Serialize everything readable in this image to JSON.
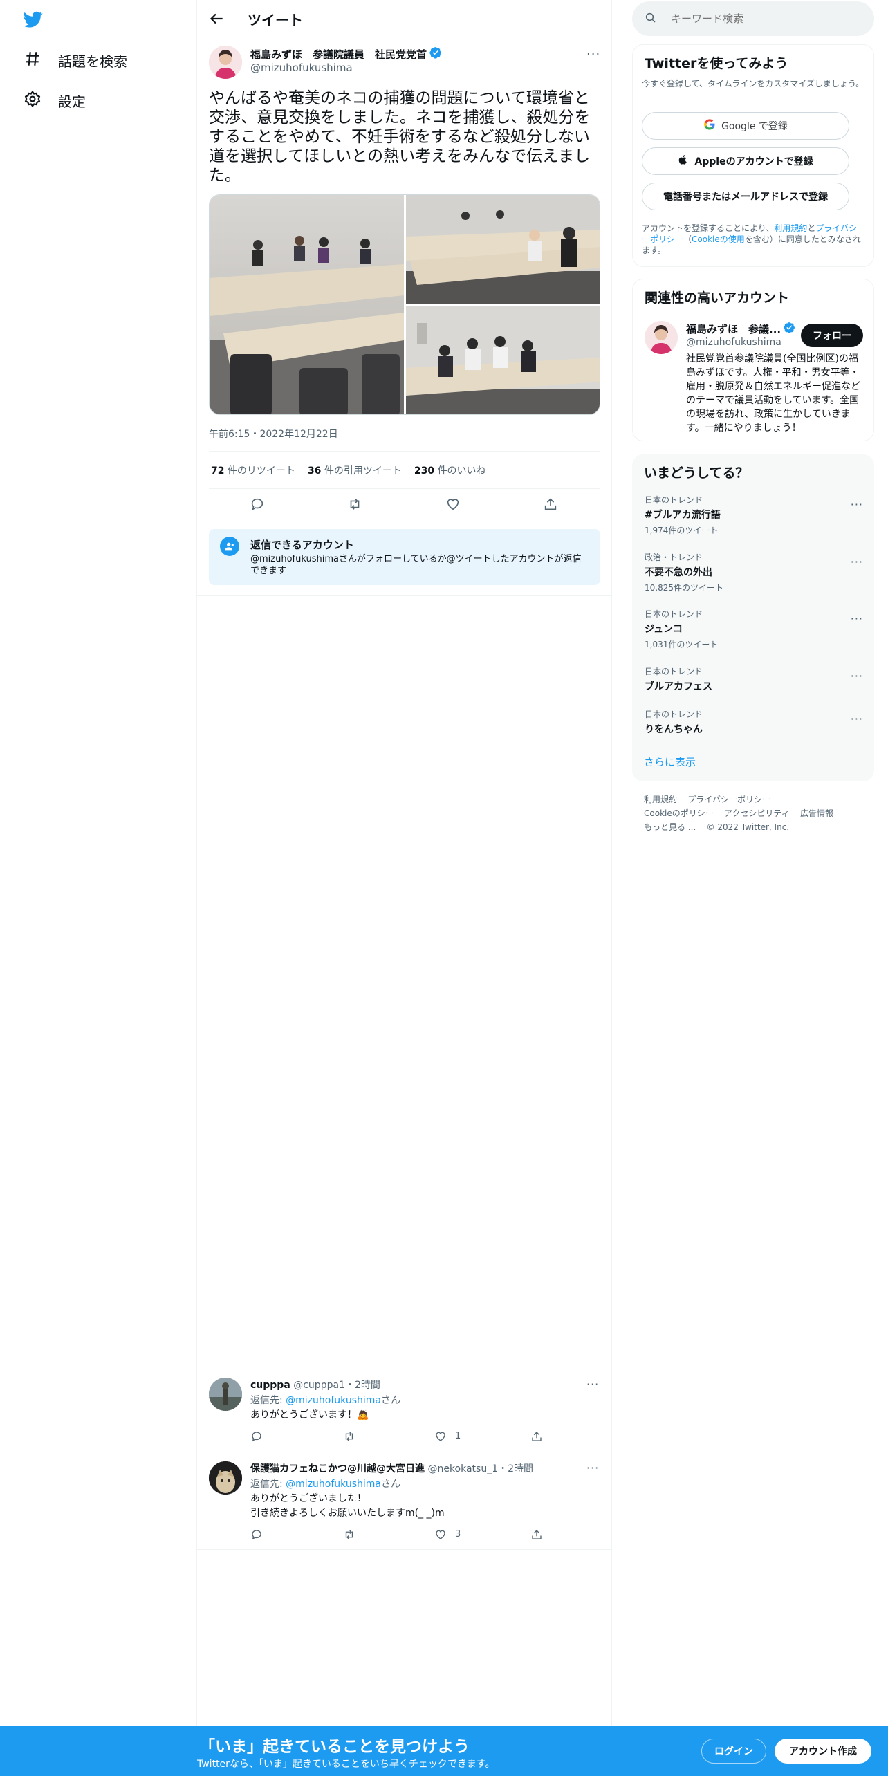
{
  "nav": {
    "items": [
      {
        "label": "話題を検索",
        "icon": "hash-icon"
      },
      {
        "label": "設定",
        "icon": "gear-icon"
      }
    ]
  },
  "header": {
    "title": "ツイート"
  },
  "tweet": {
    "author_name": "福島みずほ　参議院議員　社民党党首",
    "handle": "@mizuhofukushima",
    "text": "やんばるや奄美のネコの捕獲の問題について環境省と交渉、意見交換をしました。ネコを捕獲し、殺処分をすることをやめて、不妊手術をするなど殺処分しない道を選択してほしいとの熱い考えをみんなで伝えました。",
    "timestamp": "午前6:15・2022年12月22日",
    "stats": [
      {
        "count": "72",
        "label": "件のリツイート"
      },
      {
        "count": "36",
        "label": "件の引用ツイート"
      },
      {
        "count": "230",
        "label": "件のいいね"
      }
    ],
    "reply_notice_title": "返信できるアカウント",
    "reply_notice_text": "@mizuhofukushimaさんがフォローしているか@ツイートしたアカウントが返信できます"
  },
  "replies": [
    {
      "name": "cupppa",
      "handle": "@cupppa1",
      "time": "・2時間",
      "reply_prefix": "返信先: ",
      "reply_to": "@mizuhofukushima",
      "reply_suffix": "さん",
      "text_lines": [
        "ありがとうございます！🙇"
      ],
      "likes": "1"
    },
    {
      "name": "保護猫カフェねこかつ@川越@大宮日進",
      "handle": "@nekokatsu_1",
      "time": "・2時間",
      "reply_prefix": "返信先: ",
      "reply_to": "@mizuhofukushima",
      "reply_suffix": "さん",
      "text_lines": [
        "ありがとうございました！",
        "引き続きよろしくお願いいたしますm(_ _)m"
      ],
      "likes": "3"
    }
  ],
  "search": {
    "placeholder": "キーワード検索"
  },
  "signup": {
    "title": "Twitterを使ってみよう",
    "subtitle": "今すぐ登録して、タイムラインをカスタマイズしましょう。",
    "google_label": "Google で登録",
    "apple_label": "Appleのアカウントで登録",
    "phone_label": "電話番号またはメールアドレスで登録",
    "terms_prefix": "アカウントを登録することにより、",
    "terms_link": "利用規約",
    "terms_and": "と",
    "privacy_link": "プライバシーポリシー",
    "cookie_open": "（",
    "cookie_link": "Cookieの使用",
    "terms_suffix": "を含む）に同意したとみなされます。"
  },
  "related": {
    "title": "関連性の高いアカウント",
    "name": "福島みずほ　参議...",
    "handle": "@mizuhofukushima",
    "follow_label": "フォロー",
    "bio": "社民党党首参議院議員(全国比例区)の福島みずほです。人権・平和・男女平等・雇用・脱原発＆自然エネルギー促進などのテーマで議員活動をしています。全国の現場を訪れ、政策に生かしていきます。一緒にやりましょう！"
  },
  "trends": {
    "title": "いまどうしてる？",
    "items": [
      {
        "context": "日本のトレンド",
        "name": "#ブルアカ流行語",
        "count": "1,974件のツイート"
      },
      {
        "context": "政治・トレンド",
        "name": "不要不急の外出",
        "count": "10,825件のツイート"
      },
      {
        "context": "日本のトレンド",
        "name": "ジュンコ",
        "count": "1,031件のツイート"
      },
      {
        "context": "日本のトレンド",
        "name": "ブルアカフェス",
        "count": ""
      },
      {
        "context": "日本のトレンド",
        "name": "りをんちゃん",
        "count": ""
      }
    ],
    "show_more": "さらに表示"
  },
  "footer": {
    "links_row1": [
      "利用規約",
      "プライバシーポリシー"
    ],
    "links_row2": [
      "Cookieのポリシー",
      "アクセシビリティ",
      "広告情報"
    ],
    "more": "もっと見る ...",
    "copyright": "© 2022 Twitter, Inc."
  },
  "bottom_bar": {
    "headline": "「いま」起きていることを見つけよう",
    "subtext": "Twitterなら、「いま」起きていることをいち早くチェックできます。",
    "login_label": "ログイン",
    "signup_label": "アカウント作成"
  },
  "colors": {
    "brand": "#1d9bf0",
    "text": "#0f1419",
    "muted": "#536471"
  }
}
